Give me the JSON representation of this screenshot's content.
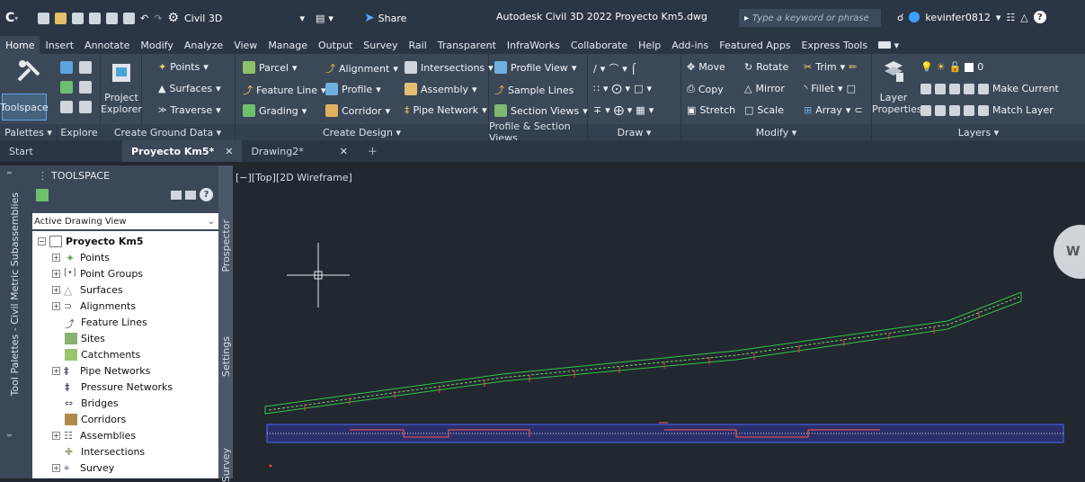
{
  "titlebar": {
    "logo": "C",
    "workspace": "Civil 3D",
    "share": "Share",
    "title": "Autodesk Civil 3D 2022  Proyecto Km5.dwg",
    "search_placeholder": "Type a keyword or phrase",
    "username": "kevinfer0812"
  },
  "menu": [
    "Home",
    "Insert",
    "Annotate",
    "Modify",
    "Analyze",
    "View",
    "Manage",
    "Output",
    "Survey",
    "Rail",
    "Transparent",
    "InfraWorks",
    "Collaborate",
    "Help",
    "Add-ins",
    "Featured Apps",
    "Express Tools"
  ],
  "ribbon": {
    "toolspace": "Toolspace",
    "project_explorer": [
      "Project",
      "Explorer"
    ],
    "points": "Points",
    "surfaces": "Surfaces",
    "traverse": "Traverse",
    "parcel": "Parcel",
    "feature_line": "Feature Line",
    "grading": "Grading",
    "alignment": "Alignment",
    "profile": "Profile",
    "corridor": "Corridor",
    "intersections": "Intersections",
    "assembly": "Assembly",
    "pipe_network": "Pipe Network",
    "profile_view": "Profile View",
    "sample_lines": "Sample Lines",
    "section_views": "Section Views",
    "move": "Move",
    "copy": "Copy",
    "stretch": "Stretch",
    "rotate": "Rotate",
    "mirror": "Mirror",
    "scale": "Scale",
    "trim": "Trim",
    "fillet": "Fillet",
    "array": "Array",
    "layer_properties": [
      "Layer",
      "Properties"
    ],
    "layer_value": "0",
    "make_current": "Make Current",
    "match_layer": "Match Layer"
  },
  "panels": [
    "Palettes ▾",
    "Explore",
    "Create Ground Data ▾",
    "Create Design ▾",
    "Profile & Section Views",
    "Draw ▾",
    "Modify ▾",
    "Layers ▾"
  ],
  "doctabs": {
    "start": "Start",
    "active": "Proyecto Km5*",
    "other": "Drawing2*"
  },
  "toolspace": {
    "title": "TOOLSPACE",
    "view": "Active Drawing View",
    "root": "Proyecto Km5",
    "items": [
      "Points",
      "Point Groups",
      "Surfaces",
      "Alignments",
      "Feature Lines",
      "Sites",
      "Catchments",
      "Pipe Networks",
      "Pressure Networks",
      "Bridges",
      "Corridors",
      "Assemblies",
      "Intersections",
      "Survey"
    ]
  },
  "sidetabs": [
    "Prospector",
    "Settings",
    "Survey"
  ],
  "leftstrip": "Tool Palettes - Civil Metric Subassemblies",
  "viewport": {
    "label": "[−][Top][2D Wireframe]",
    "compass": "W"
  }
}
